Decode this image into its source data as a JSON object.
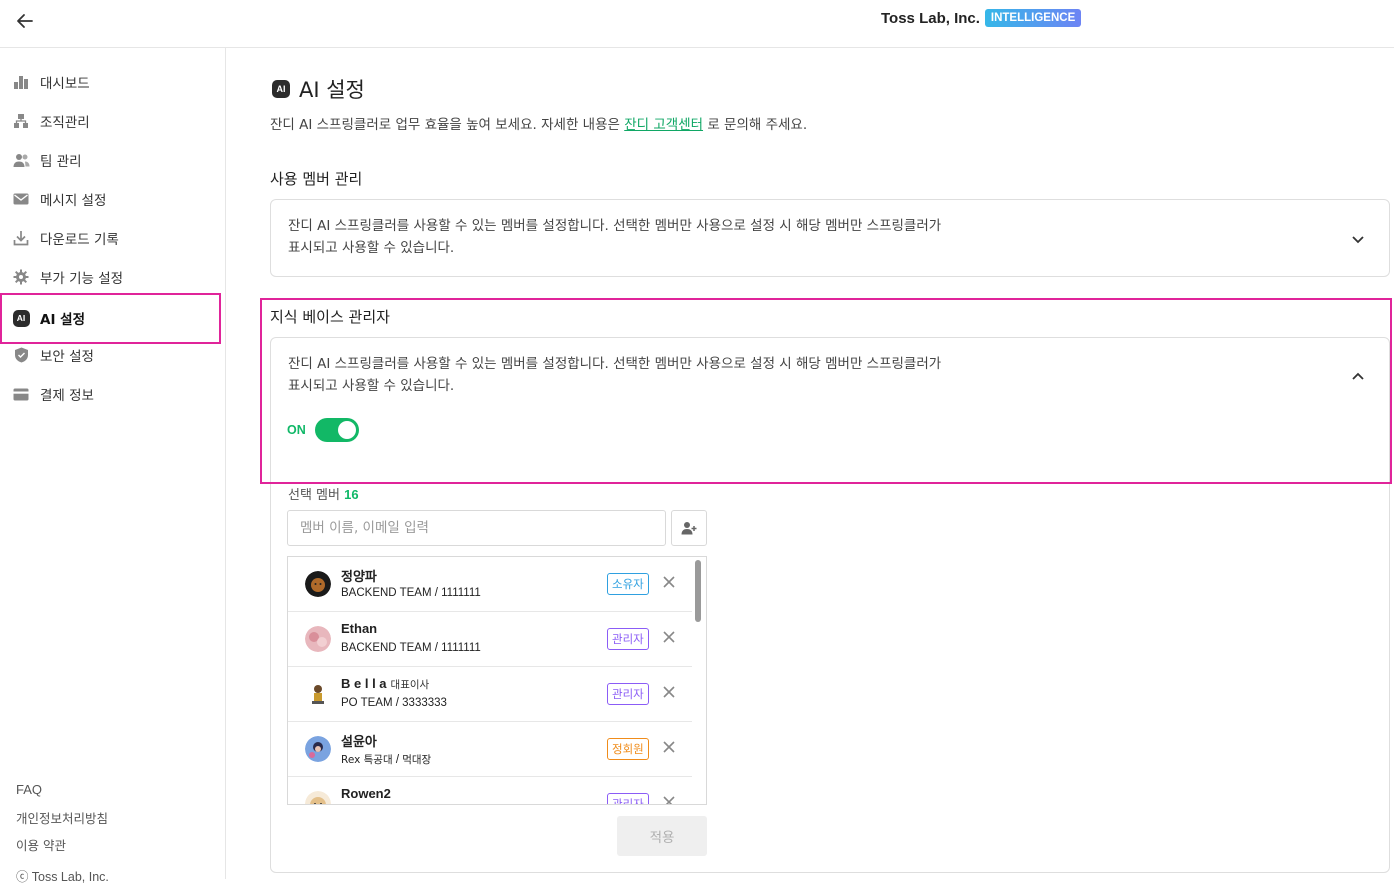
{
  "header": {
    "company": "Toss Lab, Inc.",
    "badge": "INTELLIGENCE"
  },
  "sidebar": {
    "items": [
      {
        "label": "대시보드",
        "icon": "bar-chart-icon"
      },
      {
        "label": "조직관리",
        "icon": "org-chart-icon"
      },
      {
        "label": "팀 관리",
        "icon": "team-icon"
      },
      {
        "label": "메시지 설정",
        "icon": "mail-icon"
      },
      {
        "label": "다운로드 기록",
        "icon": "download-icon"
      },
      {
        "label": "부가 기능 설정",
        "icon": "gear-icon"
      },
      {
        "label": "AI 설정",
        "icon": "ai-icon",
        "active": true
      },
      {
        "label": "보안 설정",
        "icon": "shield-icon"
      },
      {
        "label": "결제 정보",
        "icon": "card-icon"
      }
    ],
    "footer": {
      "faq": "FAQ",
      "privacy": "개인정보처리방침",
      "terms": "이용 약관",
      "copyright": "ⓒ Toss Lab, Inc."
    }
  },
  "page": {
    "ai_chip": "AI",
    "title": "AI 설정",
    "desc_before": "잔디 AI 스프링클러로 업무 효율을 높여 보세요. 자세한 내용은 ",
    "desc_link": "잔디 고객센터",
    "desc_after": " 로 문의해 주세요."
  },
  "sections": {
    "members": {
      "title": "사용 멤버 관리",
      "desc_line1": "잔디 AI 스프링클러를 사용할 수 있는 멤버를 설정합니다. 선택한 멤버만 사용으로 설정 시 해당 멤버만 스프링클러가",
      "desc_line2": "표시되고 사용할 수 있습니다."
    },
    "kb_admin": {
      "title": "지식 베이스 관리자",
      "desc_line1": "잔디 AI 스프링클러를 사용할 수 있는 멤버를 설정합니다. 선택한 멤버만 사용으로 설정 시 해당 멤버만 스프링클러가",
      "desc_line2": "표시되고 사용할 수 있습니다.",
      "toggle_label": "ON",
      "toggle_on": true,
      "selected_label": "선택 멤버",
      "selected_count": "16",
      "search_placeholder": "멤버 이름, 이메일 입력",
      "apply_label": "적용"
    }
  },
  "members": [
    {
      "name": "정양파",
      "title": "",
      "team": "BACKEND TEAM",
      "id": "1111111",
      "role": "소유자",
      "role_color": "#2fa0e0",
      "avatar": "dark"
    },
    {
      "name": "Ethan",
      "title": "",
      "team": "BACKEND TEAM",
      "id": "1111111",
      "role": "관리자",
      "role_color": "#8b5cf6",
      "avatar": "pink"
    },
    {
      "name": "B e l l a",
      "title": "대표이사",
      "team": "PO TEAM",
      "id": "3333333",
      "role": "관리자",
      "role_color": "#8b5cf6",
      "avatar": "figure"
    },
    {
      "name": "설윤아",
      "title": "",
      "team": "Rex 특공대",
      "id": "먹대장",
      "role": "정회원",
      "role_color": "#f08c1a",
      "avatar": "blue"
    },
    {
      "name": "Rowen2",
      "title": "",
      "team": "",
      "id": "",
      "role": "관리자",
      "role_color": "#8b5cf6",
      "avatar": "bear"
    }
  ]
}
